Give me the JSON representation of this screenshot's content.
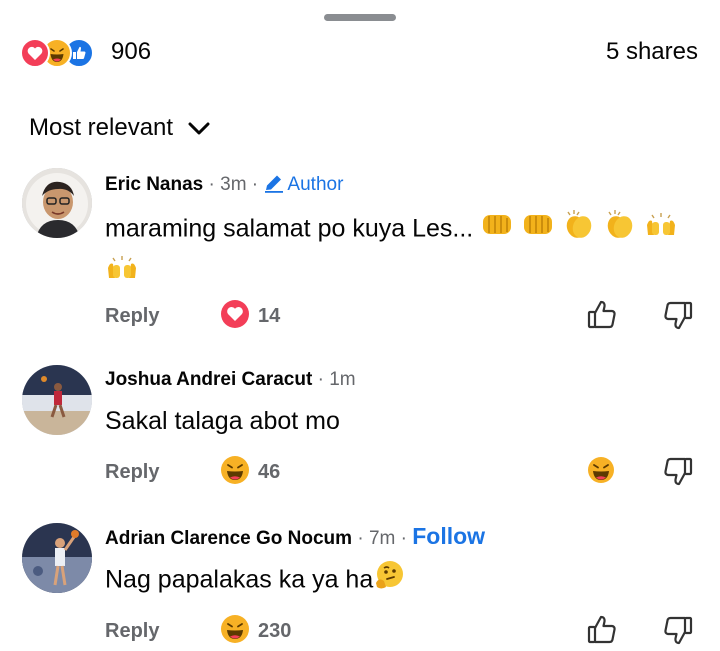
{
  "summary": {
    "reaction_icons": [
      "love",
      "haha",
      "like"
    ],
    "reaction_count": "906",
    "shares": "5 shares"
  },
  "sort": {
    "label": "Most relevant"
  },
  "comments": [
    {
      "name": "Eric Nanas",
      "separator": " · ",
      "time": "3m",
      "badge": "Author",
      "text": "maraming salamat po kuya Les...",
      "emojis": [
        "fist-bump",
        "fist-bump",
        "clapping-hands",
        "clapping-hands",
        "raising-hands",
        "raising-hands"
      ],
      "reply_label": "Reply",
      "reaction_icon": "love",
      "reaction_count": "14"
    },
    {
      "name": "Joshua Andrei Caracut",
      "separator": " · ",
      "time": "1m",
      "text": "Sakal talaga abot mo",
      "reply_label": "Reply",
      "reaction_icon": "haha",
      "reaction_count": "46",
      "user_reaction": "haha"
    },
    {
      "name": "Adrian Clarence Go Nocum",
      "separator": " · ",
      "time": "7m",
      "follow": "Follow",
      "text": "Nag papalakas ka ya ha",
      "emojis": [
        "thinking-face"
      ],
      "reply_label": "Reply",
      "reaction_icon": "haha",
      "reaction_count": "230"
    }
  ],
  "colors": {
    "accent": "#1b74e4",
    "love": "#f33e58",
    "haha": "#f7b125",
    "secondary_text": "#65676b"
  }
}
